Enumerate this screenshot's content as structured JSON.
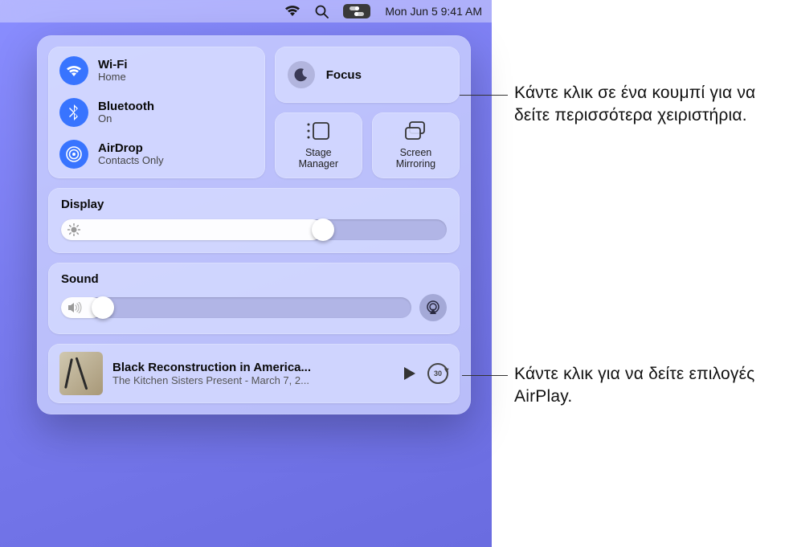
{
  "menubar": {
    "date_time": "Mon Jun 5  9:41 AM"
  },
  "control_center": {
    "wifi": {
      "title": "Wi-Fi",
      "subtitle": "Home"
    },
    "bluetooth": {
      "title": "Bluetooth",
      "subtitle": "On"
    },
    "airdrop": {
      "title": "AirDrop",
      "subtitle": "Contacts Only"
    },
    "focus": {
      "title": "Focus"
    },
    "stage_manager": {
      "label": "Stage\nManager"
    },
    "screen_mirroring": {
      "label": "Screen\nMirroring"
    },
    "display": {
      "label": "Display",
      "value_percent": 68
    },
    "sound": {
      "label": "Sound",
      "value_percent": 12
    },
    "media": {
      "title": "Black Reconstruction in America...",
      "subtitle": "The Kitchen Sisters Present - March 7, 2...",
      "skip_seconds": "30"
    }
  },
  "annotations": {
    "focus_hint": "Κάντε κλικ σε ένα κουμπί για να δείτε περισσότερα χειριστήρια.",
    "airplay_hint": "Κάντε κλικ για να δείτε επιλογές AirPlay."
  }
}
